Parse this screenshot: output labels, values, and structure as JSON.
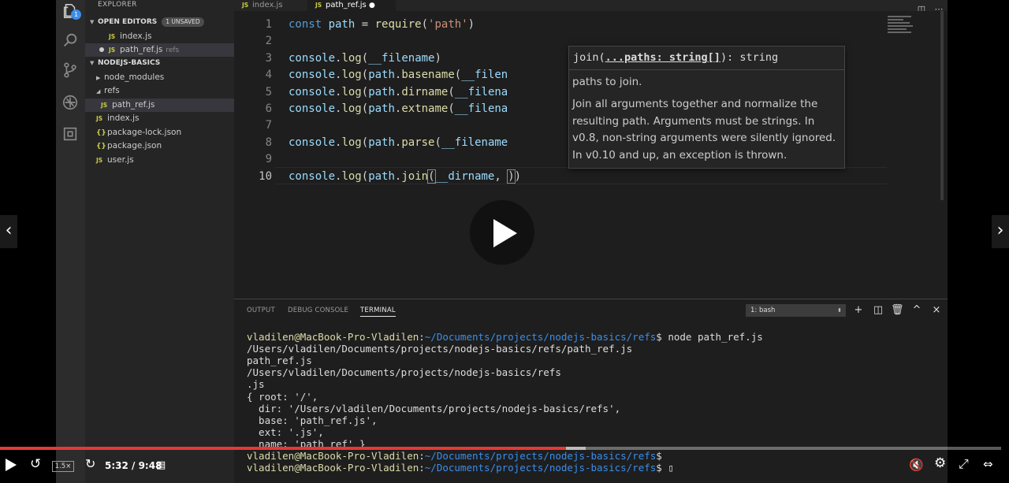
{
  "sidebar": {
    "title": "EXPLORER",
    "open_editors": {
      "label": "OPEN EDITORS",
      "badge": "1 UNSAVED"
    },
    "open_files": [
      {
        "name": "index.js",
        "hint": ""
      },
      {
        "name": "path_ref.js",
        "hint": "refs"
      }
    ],
    "project": {
      "label": "NODEJS-BASICS"
    },
    "tree": [
      {
        "name": "node_modules",
        "kind": "folder"
      },
      {
        "name": "refs",
        "kind": "folder"
      },
      {
        "name": "path_ref.js",
        "kind": "js"
      },
      {
        "name": "index.js",
        "kind": "js"
      },
      {
        "name": "package-lock.json",
        "kind": "json"
      },
      {
        "name": "package.json",
        "kind": "json"
      },
      {
        "name": "user.js",
        "kind": "js"
      }
    ],
    "notification_count": "1"
  },
  "tabs": [
    {
      "label": "index.js"
    },
    {
      "label": "path_ref.js"
    }
  ],
  "editor": {
    "line_numbers": [
      "1",
      "2",
      "3",
      "4",
      "5",
      "6",
      "7",
      "8",
      "9",
      "10"
    ],
    "lines": [
      [
        [
          "k",
          "const "
        ],
        [
          "v",
          "path"
        ],
        [
          "p",
          " = "
        ],
        [
          "f",
          "require"
        ],
        [
          "p",
          "("
        ],
        [
          "s",
          "'path'"
        ],
        [
          "p",
          ")"
        ]
      ],
      [],
      [
        [
          "v",
          "console"
        ],
        [
          "p",
          "."
        ],
        [
          "f",
          "log"
        ],
        [
          "p",
          "("
        ],
        [
          "v",
          "__filename"
        ],
        [
          "p",
          ")"
        ]
      ],
      [
        [
          "v",
          "console"
        ],
        [
          "p",
          "."
        ],
        [
          "f",
          "log"
        ],
        [
          "p",
          "("
        ],
        [
          "v",
          "path"
        ],
        [
          "p",
          "."
        ],
        [
          "f",
          "basename"
        ],
        [
          "p",
          "("
        ],
        [
          "v",
          "__filen"
        ]
      ],
      [
        [
          "v",
          "console"
        ],
        [
          "p",
          "."
        ],
        [
          "f",
          "log"
        ],
        [
          "p",
          "("
        ],
        [
          "v",
          "path"
        ],
        [
          "p",
          "."
        ],
        [
          "f",
          "dirname"
        ],
        [
          "p",
          "("
        ],
        [
          "v",
          "__filena"
        ]
      ],
      [
        [
          "v",
          "console"
        ],
        [
          "p",
          "."
        ],
        [
          "f",
          "log"
        ],
        [
          "p",
          "("
        ],
        [
          "v",
          "path"
        ],
        [
          "p",
          "."
        ],
        [
          "f",
          "extname"
        ],
        [
          "p",
          "("
        ],
        [
          "v",
          "__filena"
        ]
      ],
      [],
      [
        [
          "v",
          "console"
        ],
        [
          "p",
          "."
        ],
        [
          "f",
          "log"
        ],
        [
          "p",
          "("
        ],
        [
          "v",
          "path"
        ],
        [
          "p",
          "."
        ],
        [
          "f",
          "parse"
        ],
        [
          "p",
          "("
        ],
        [
          "v",
          "__filename"
        ]
      ],
      [],
      [
        [
          "v",
          "console"
        ],
        [
          "p",
          "."
        ],
        [
          "f",
          "log"
        ],
        [
          "p",
          "("
        ],
        [
          "v",
          "path"
        ],
        [
          "p",
          "."
        ],
        [
          "f",
          "join"
        ],
        [
          "p",
          "("
        ],
        [
          "v",
          "__dirname"
        ],
        [
          "p",
          ", "
        ],
        [
          "p",
          ")"
        ],
        [
          "p",
          ")"
        ]
      ]
    ]
  },
  "hover": {
    "sig_prefix": "join(",
    "sig_param": "...paths: string[]",
    "sig_suffix": "): string",
    "param_doc": "paths to join.",
    "doc": "Join all arguments together and normalize the resulting path. Arguments must be strings. In v0.8, non-string arguments were silently ignored. In v0.10 and up, an exception is thrown."
  },
  "panel": {
    "tabs": [
      "OUTPUT",
      "DEBUG CONSOLE",
      "TERMINAL"
    ],
    "active_tab": "TERMINAL",
    "terminal_select": "1: bash",
    "terminal": [
      {
        "user": "vladilen@MacBook-Pro-Vladilen",
        "path": "~/Documents/projects/nodejs-basics/refs",
        "cmd": "$ node path_ref.js"
      },
      {
        "text": "/Users/vladilen/Documents/projects/nodejs-basics/refs/path_ref.js"
      },
      {
        "text": "path_ref.js"
      },
      {
        "text": "/Users/vladilen/Documents/projects/nodejs-basics/refs"
      },
      {
        "text": ".js"
      },
      {
        "text": "{ root: '/',"
      },
      {
        "text": "  dir: '/Users/vladilen/Documents/projects/nodejs-basics/refs',"
      },
      {
        "text": "  base: 'path_ref.js',"
      },
      {
        "text": "  ext: '.js',"
      },
      {
        "text": "  name: 'path_ref' }"
      },
      {
        "user": "vladilen@MacBook-Pro-Vladilen",
        "path": "~/Documents/projects/nodejs-basics/refs",
        "cmd": "$"
      },
      {
        "user": "vladilen@MacBook-Pro-Vladilen",
        "path": "~/Documents/projects/nodejs-basics/refs",
        "cmd": "$ ▯"
      }
    ]
  },
  "player": {
    "speed": "1.5×",
    "time": "5:32 / 9:48",
    "progress": 0.565,
    "buffered": 0.585,
    "colors": {
      "progress": "#e53935"
    }
  }
}
